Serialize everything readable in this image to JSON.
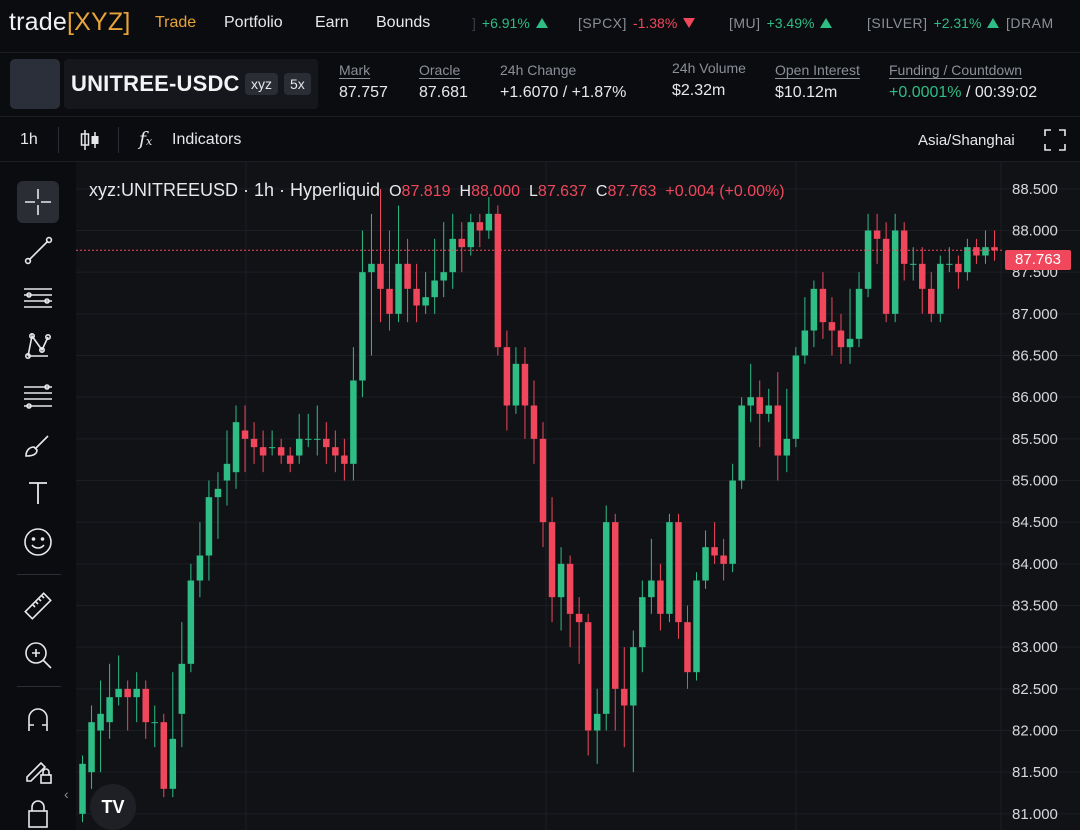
{
  "brand": {
    "logo_text": "trade",
    "logo_bracket_open": "[",
    "logo_name": "XYZ",
    "logo_bracket_close": "]"
  },
  "nav": {
    "trade": "Trade",
    "portfolio": "Portfolio",
    "earn": "Earn",
    "bounds": "Bounds"
  },
  "tickers": [
    {
      "sym": "",
      "change": "+6.91%",
      "dir": "up"
    },
    {
      "sym": "[SPCX]",
      "change": "-1.38%",
      "dir": "down"
    },
    {
      "sym": "[MU]",
      "change": "+3.49%",
      "dir": "up"
    },
    {
      "sym": "[SILVER]",
      "change": "+2.31%",
      "dir": "up"
    },
    {
      "sym": "[DRAM",
      "change": "",
      "dir": ""
    }
  ],
  "market": {
    "name": "UNITREE-USDC",
    "badge_dex": "xyz",
    "badge_leverage": "5x",
    "mark_label": "Mark",
    "mark_value": "87.757",
    "oracle_label": "Oracle",
    "oracle_value": "87.681",
    "change_label": "24h Change",
    "change_value": "+1.6070 / +1.87%",
    "volume_label": "24h Volume",
    "volume_value": "$2.32m",
    "oi_label": "Open Interest",
    "oi_value": "$10.12m",
    "funding_label": "Funding / Countdown",
    "funding_rate": "+0.0001%",
    "funding_sep": " / ",
    "countdown": "00:39:02"
  },
  "toolbar": {
    "interval": "1h",
    "indicators": "Indicators",
    "timezone": "Asia/Shanghai"
  },
  "legend": {
    "symbol": "xyz:UNITREEUSD · 1h · Hyperliquid",
    "o_label": "O",
    "o": "87.819",
    "h_label": "H",
    "h": "88.000",
    "l_label": "L",
    "l": "87.637",
    "c_label": "C",
    "c": "87.763",
    "chg": "+0.004 (+0.00%)"
  },
  "colors": {
    "up": "#2ebd85",
    "down": "#f0475c",
    "accent": "#e8a33a",
    "bg": "#111216"
  },
  "chart_data": {
    "type": "candlestick",
    "y_ticks": [
      "88.500",
      "88.000",
      "87.500",
      "87.000",
      "86.500",
      "86.000",
      "85.500",
      "85.000",
      "84.500",
      "84.000",
      "83.500",
      "83.000",
      "82.500",
      "82.000",
      "81.500",
      "81.000"
    ],
    "ylim": [
      80.95,
      88.75
    ],
    "last_price": "87.763",
    "last_value": 87.763,
    "candles": [
      [
        81.0,
        81.6,
        80.9,
        81.7
      ],
      [
        81.5,
        82.1,
        81.3,
        82.3
      ],
      [
        82.0,
        82.2,
        81.5,
        82.6
      ],
      [
        82.1,
        82.4,
        81.9,
        82.8
      ],
      [
        82.4,
        82.5,
        82.3,
        82.9
      ],
      [
        82.5,
        82.4,
        82.0,
        82.6
      ],
      [
        82.4,
        82.5,
        82.1,
        82.7
      ],
      [
        82.5,
        82.1,
        81.9,
        82.6
      ],
      [
        82.1,
        82.1,
        81.8,
        82.3
      ],
      [
        82.1,
        81.3,
        81.2,
        82.2
      ],
      [
        81.3,
        81.9,
        81.2,
        82.7
      ],
      [
        82.2,
        82.8,
        81.8,
        83.3
      ],
      [
        82.8,
        83.8,
        82.7,
        84.0
      ],
      [
        83.8,
        84.1,
        83.6,
        84.5
      ],
      [
        84.1,
        84.8,
        83.8,
        85.0
      ],
      [
        84.8,
        84.9,
        84.3,
        85.1
      ],
      [
        85.0,
        85.2,
        84.7,
        85.6
      ],
      [
        85.1,
        85.7,
        84.9,
        85.9
      ],
      [
        85.6,
        85.5,
        85.1,
        85.9
      ],
      [
        85.5,
        85.4,
        85.2,
        85.7
      ],
      [
        85.4,
        85.3,
        85.1,
        85.6
      ],
      [
        85.4,
        85.4,
        85.3,
        85.6
      ],
      [
        85.4,
        85.3,
        85.2,
        85.5
      ],
      [
        85.3,
        85.2,
        85.1,
        85.4
      ],
      [
        85.3,
        85.5,
        85.2,
        85.8
      ],
      [
        85.5,
        85.5,
        85.4,
        85.8
      ],
      [
        85.5,
        85.5,
        85.3,
        85.9
      ],
      [
        85.5,
        85.4,
        85.2,
        85.7
      ],
      [
        85.4,
        85.3,
        85.1,
        85.6
      ],
      [
        85.3,
        85.2,
        85.0,
        85.5
      ],
      [
        85.2,
        86.2,
        85.0,
        86.6
      ],
      [
        86.2,
        87.5,
        86.0,
        88.0
      ],
      [
        87.5,
        87.6,
        86.5,
        88.2
      ],
      [
        87.6,
        87.3,
        86.9,
        88.5
      ],
      [
        87.3,
        87.0,
        86.8,
        88.0
      ],
      [
        87.0,
        87.6,
        86.9,
        88.3
      ],
      [
        87.6,
        87.3,
        86.9,
        87.9
      ],
      [
        87.3,
        87.1,
        86.9,
        87.6
      ],
      [
        87.1,
        87.2,
        87.0,
        87.5
      ],
      [
        87.2,
        87.4,
        87.0,
        87.9
      ],
      [
        87.4,
        87.5,
        87.2,
        88.1
      ],
      [
        87.5,
        87.9,
        87.3,
        88.2
      ],
      [
        87.9,
        87.8,
        87.5,
        88.1
      ],
      [
        87.8,
        88.1,
        87.7,
        88.2
      ],
      [
        88.1,
        88.0,
        87.8,
        88.2
      ],
      [
        88.0,
        88.2,
        87.9,
        88.4
      ],
      [
        88.2,
        86.6,
        86.5,
        88.3
      ],
      [
        86.6,
        85.9,
        85.6,
        86.8
      ],
      [
        85.9,
        86.4,
        85.8,
        86.6
      ],
      [
        86.4,
        85.9,
        85.5,
        86.6
      ],
      [
        85.9,
        85.5,
        85.2,
        86.2
      ],
      [
        85.5,
        84.5,
        84.2,
        85.7
      ],
      [
        84.5,
        83.6,
        83.3,
        84.8
      ],
      [
        83.6,
        84.0,
        83.2,
        84.2
      ],
      [
        84.0,
        83.4,
        83.0,
        84.1
      ],
      [
        83.4,
        83.3,
        82.8,
        83.6
      ],
      [
        83.3,
        82.0,
        81.7,
        83.4
      ],
      [
        82.0,
        82.2,
        81.6,
        82.5
      ],
      [
        82.2,
        84.5,
        82.0,
        84.7
      ],
      [
        84.5,
        82.5,
        82.0,
        84.6
      ],
      [
        82.5,
        82.3,
        81.8,
        83.0
      ],
      [
        82.3,
        83.0,
        81.5,
        83.2
      ],
      [
        83.0,
        83.6,
        82.7,
        83.8
      ],
      [
        83.6,
        83.8,
        83.4,
        84.3
      ],
      [
        83.8,
        83.4,
        83.2,
        84.0
      ],
      [
        83.4,
        84.5,
        83.3,
        84.6
      ],
      [
        84.5,
        83.3,
        83.1,
        84.6
      ],
      [
        83.3,
        82.7,
        82.5,
        83.5
      ],
      [
        82.7,
        83.8,
        82.6,
        83.9
      ],
      [
        83.8,
        84.2,
        83.7,
        84.4
      ],
      [
        84.2,
        84.1,
        84.0,
        84.5
      ],
      [
        84.1,
        84.0,
        83.8,
        84.3
      ],
      [
        84.0,
        85.0,
        83.9,
        85.2
      ],
      [
        85.0,
        85.9,
        84.9,
        86.0
      ],
      [
        85.9,
        86.0,
        85.7,
        86.4
      ],
      [
        86.0,
        85.8,
        85.4,
        86.2
      ],
      [
        85.8,
        85.9,
        85.7,
        86.1
      ],
      [
        85.9,
        85.3,
        85.0,
        86.3
      ],
      [
        85.3,
        85.5,
        85.1,
        86.1
      ],
      [
        85.5,
        86.5,
        85.4,
        86.6
      ],
      [
        86.5,
        86.8,
        86.4,
        87.2
      ],
      [
        86.8,
        87.3,
        86.6,
        87.4
      ],
      [
        87.3,
        86.9,
        86.7,
        87.5
      ],
      [
        86.9,
        86.8,
        86.5,
        87.2
      ],
      [
        86.8,
        86.6,
        86.4,
        87.0
      ],
      [
        86.6,
        86.7,
        86.4,
        87.3
      ],
      [
        86.7,
        87.3,
        86.6,
        87.5
      ],
      [
        87.3,
        88.0,
        87.2,
        88.2
      ],
      [
        88.0,
        87.9,
        87.6,
        88.2
      ],
      [
        87.9,
        87.0,
        86.9,
        88.1
      ],
      [
        87.0,
        88.0,
        86.9,
        88.2
      ],
      [
        88.0,
        87.6,
        87.4,
        88.1
      ],
      [
        87.6,
        87.6,
        87.4,
        87.8
      ],
      [
        87.6,
        87.3,
        87.0,
        87.8
      ],
      [
        87.3,
        87.0,
        86.9,
        87.5
      ],
      [
        87.0,
        87.6,
        86.9,
        87.7
      ],
      [
        87.6,
        87.6,
        87.5,
        87.8
      ],
      [
        87.6,
        87.5,
        87.3,
        87.7
      ],
      [
        87.5,
        87.8,
        87.4,
        87.9
      ],
      [
        87.8,
        87.7,
        87.6,
        87.9
      ],
      [
        87.7,
        87.8,
        87.6,
        88.0
      ],
      [
        87.8,
        87.763,
        87.637,
        88.0
      ]
    ]
  }
}
